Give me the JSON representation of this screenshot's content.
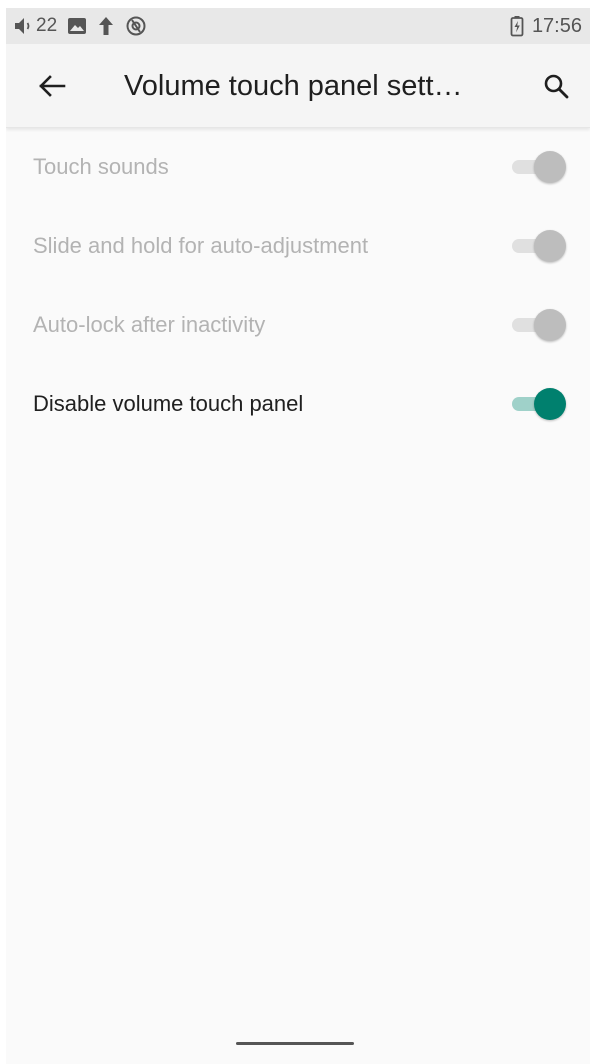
{
  "status_bar": {
    "notification_count": "22",
    "icons": [
      "volume-icon",
      "image-icon",
      "upload-arrow-icon",
      "sync-icon"
    ],
    "battery_icon": "battery-charging-icon",
    "time": "17:56"
  },
  "app_bar": {
    "back_icon": "back-arrow-icon",
    "title": "Volume touch panel sett…",
    "search_icon": "search-icon"
  },
  "settings": [
    {
      "label": "Touch sounds",
      "enabled": false,
      "checked": false
    },
    {
      "label": "Slide and hold for auto-adjustment",
      "enabled": false,
      "checked": false
    },
    {
      "label": "Auto-lock after inactivity",
      "enabled": false,
      "checked": false
    },
    {
      "label": "Disable volume touch panel",
      "enabled": true,
      "checked": true
    }
  ],
  "colors": {
    "accent": "#00806e",
    "accent_track": "#9fd1c9",
    "disabled_text": "#b3b3b3",
    "primary_text": "#202020",
    "background": "#fafafa",
    "status_bar": "#e8e8e8"
  }
}
